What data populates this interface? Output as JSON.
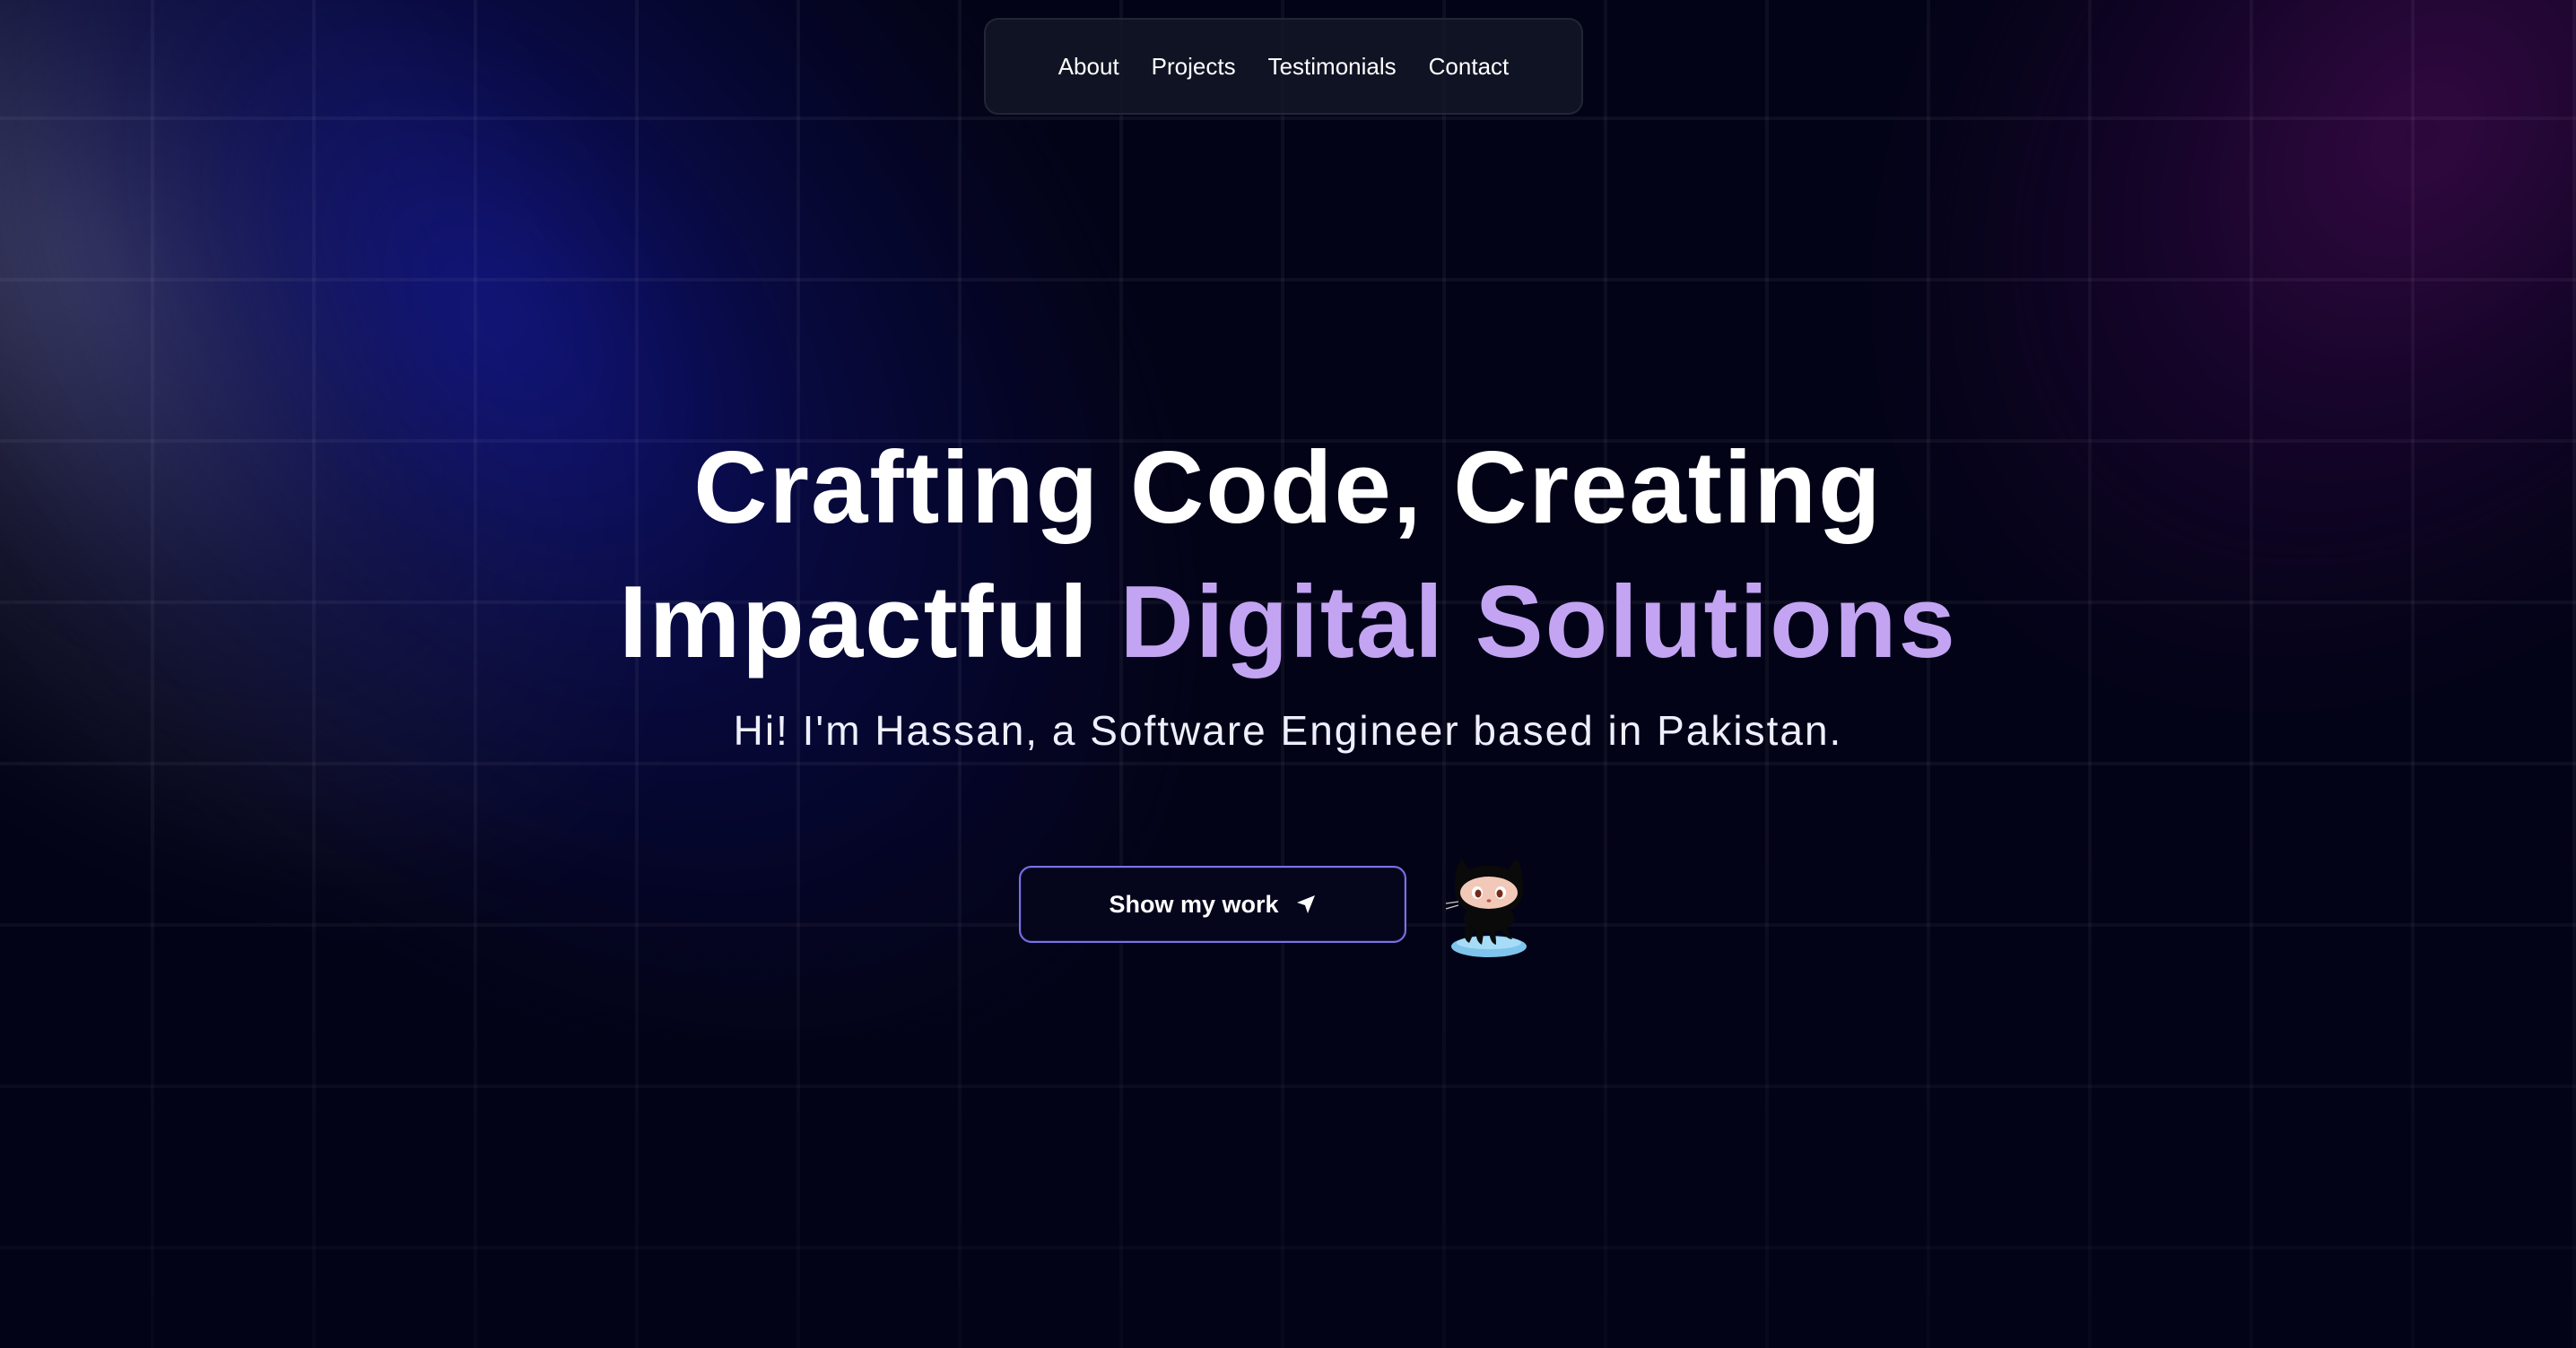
{
  "nav": {
    "items": [
      {
        "label": "About"
      },
      {
        "label": "Projects"
      },
      {
        "label": "Testimonials"
      },
      {
        "label": "Contact"
      }
    ]
  },
  "hero": {
    "headline_line1": "Crafting Code, Creating",
    "headline_line2_plain": "Impactful",
    "headline_line2_accent": "Digital Solutions",
    "subtitle": "Hi! I'm Hassan, a Software Engineer based in Pakistan."
  },
  "cta": {
    "label": "Show my work",
    "icon": "send-arrow-icon"
  },
  "mascot": {
    "icon": "octocat-mascot"
  },
  "colors": {
    "background": "#030317",
    "accent_text": "#c3a4f2",
    "button_border": "#7a71e6",
    "beam_blue": "#12168c",
    "beam_purple": "#5a0c64"
  }
}
